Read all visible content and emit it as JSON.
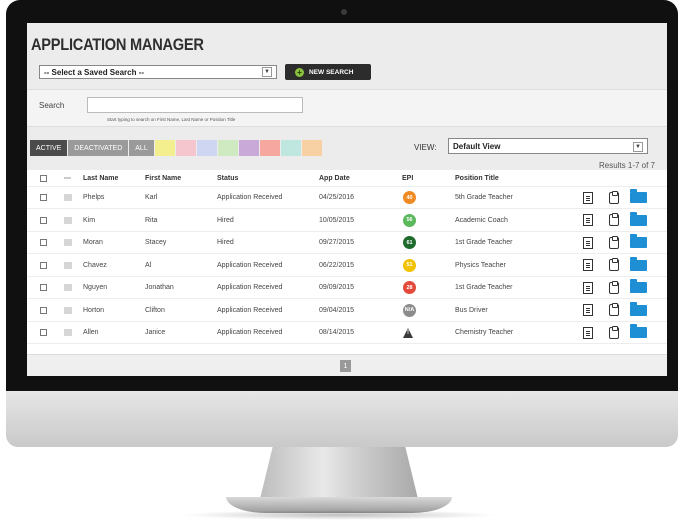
{
  "app": {
    "title": "APPLICATION MANAGER"
  },
  "saved_search": {
    "selected": "-- Select a Saved Search --",
    "new_search_label": "NEW SEARCH"
  },
  "search": {
    "label": "Search",
    "value": "",
    "hint": "Start typing to search on First Name, Last Name or Position Title"
  },
  "tabs": [
    {
      "label": "ACTIVE",
      "active": true
    },
    {
      "label": "DEACTIVATED",
      "active": false
    },
    {
      "label": "ALL",
      "active": false
    }
  ],
  "color_filters": [
    "#f4ef8e",
    "#f6c6cf",
    "#cfd6f1",
    "#cfe9c1",
    "#c9a9d8",
    "#f6a8a0",
    "#bfe6df",
    "#f7d1a4"
  ],
  "view": {
    "label": "VIEW:",
    "selected": "Default View"
  },
  "results_text": "Results 1-7 of 7",
  "columns": [
    "Last Name",
    "First Name",
    "Status",
    "App Date",
    "EPI",
    "Position Title"
  ],
  "rows": [
    {
      "last": "Phelps",
      "first": "Karl",
      "status": "Application Received",
      "date": "04/25/2016",
      "epi": "40",
      "epi_color": "#f08a24",
      "position": "5th Grade Teacher"
    },
    {
      "last": "Kim",
      "first": "Rita",
      "status": "Hired",
      "date": "10/05/2015",
      "epi": "56",
      "epi_color": "#5cb85c",
      "position": "Academic Coach"
    },
    {
      "last": "Moran",
      "first": "Stacey",
      "status": "Hired",
      "date": "09/27/2015",
      "epi": "61",
      "epi_color": "#1f6b2e",
      "position": "1st Grade Teacher"
    },
    {
      "last": "Chavez",
      "first": "Al",
      "status": "Application Received",
      "date": "06/22/2015",
      "epi": "51",
      "epi_color": "#f2c200",
      "position": "Physics Teacher"
    },
    {
      "last": "Nguyen",
      "first": "Jonathan",
      "status": "Application Received",
      "date": "09/09/2015",
      "epi": "28",
      "epi_color": "#e34a3b",
      "position": "1st Grade Teacher"
    },
    {
      "last": "Horton",
      "first": "Clifton",
      "status": "Application Received",
      "date": "09/04/2015",
      "epi": "N/A",
      "epi_color": "#8c8c8c",
      "position": "Bus Driver"
    },
    {
      "last": "Allen",
      "first": "Janice",
      "status": "Application Received",
      "date": "08/14/2015",
      "epi": "",
      "epi_color": "",
      "position": "Chemistry Teacher"
    }
  ],
  "pagination": {
    "current": "1"
  }
}
